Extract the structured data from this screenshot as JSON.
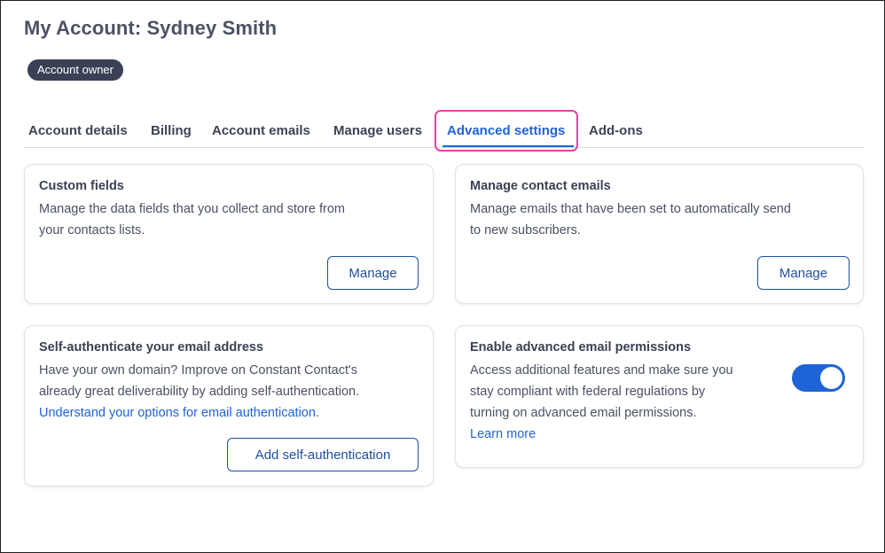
{
  "page": {
    "title": "My Account: Sydney Smith",
    "role_badge": "Account owner"
  },
  "tabs": [
    {
      "label": "Account details",
      "active": false
    },
    {
      "label": "Billing",
      "active": false
    },
    {
      "label": "Account emails",
      "active": false
    },
    {
      "label": "Manage users",
      "active": false
    },
    {
      "label": "Advanced settings",
      "active": true
    },
    {
      "label": "Add-ons",
      "active": false
    }
  ],
  "cards": {
    "custom_fields": {
      "title": "Custom fields",
      "description_line1": "Manage the data fields that you collect and store from",
      "description_line2": "your contacts lists.",
      "button": "Manage"
    },
    "manage_contact_emails": {
      "title": "Manage contact emails",
      "description_line1": "Manage emails that have been set to automatically send",
      "description_line2": "to new subscribers.",
      "button": "Manage"
    },
    "self_authenticate": {
      "title": "Self-authenticate your email address",
      "description_line1": "Have your own domain? Improve on Constant Contact's",
      "description_line2": "already great deliverability by adding self-authentication.",
      "link": "Understand your options for email authentication",
      "link_suffix": ".",
      "button": "Add self-authentication"
    },
    "advanced_permissions": {
      "title": "Enable advanced email permissions",
      "description_line1": "Access additional features and make sure you",
      "description_line2": "stay compliant with federal regulations by",
      "description_line3": "turning on advanced email permissions.",
      "link": "Learn more",
      "toggle_on": true
    }
  },
  "colors": {
    "accent": "#1f63d8",
    "highlight": "#e0479e",
    "badge_bg": "#3a4156"
  }
}
